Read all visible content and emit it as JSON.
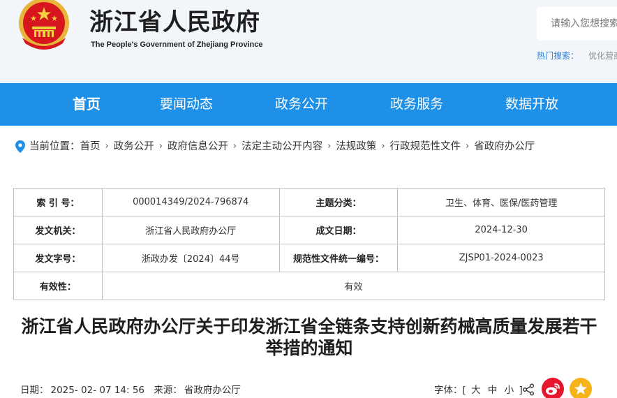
{
  "header": {
    "title": "浙江省人民政府",
    "subtitle": "The People's Government of Zhejiang Province",
    "search_placeholder": "请输入您想搜索的内容",
    "hot_search_label": "热门搜索：",
    "hot_search_items": [
      "优化营商环境"
    ]
  },
  "nav": {
    "items": [
      {
        "label": "首页",
        "active": true
      },
      {
        "label": "要闻动态",
        "active": false
      },
      {
        "label": "政务公开",
        "active": false
      },
      {
        "label": "政务服务",
        "active": false
      },
      {
        "label": "数据开放",
        "active": false
      }
    ]
  },
  "breadcrumb": {
    "label": "当前位置：",
    "items": [
      "首页",
      "政务公开",
      "政府信息公开",
      "法定主动公开内容",
      "法规政策",
      "行政规范性文件",
      "省政府办公厅"
    ],
    "separator": "›"
  },
  "meta": {
    "rows": [
      [
        {
          "label": "索 引 号：",
          "value": "000014349/2024-796874"
        },
        {
          "label": "主题分类：",
          "value": "卫生、体育、医保/医药管理"
        }
      ],
      [
        {
          "label": "发文机关：",
          "value": "浙江省人民政府办公厅"
        },
        {
          "label": "成文日期：",
          "value": "2024-12-30"
        }
      ],
      [
        {
          "label": "发文字号：",
          "value": "浙政办发〔2024〕44号"
        },
        {
          "label": "规范性文件统一编号：",
          "value": "ZJSP01-2024-0023"
        }
      ]
    ],
    "validity_label": "有效性：",
    "validity_value": "有效"
  },
  "article": {
    "title": "浙江省人民政府办公厅关于印发浙江省全链条支持创新药械高质量发展若干举措的通知",
    "date_label": "日期：",
    "date_value": "2025- 02- 07 14: 56",
    "source_label": "来源：",
    "source_value": "省政府办公厅",
    "font_label": "字体：",
    "font_bracket_open": "[",
    "font_options": [
      "大",
      "中",
      "小"
    ],
    "font_bracket_close": "]"
  },
  "colors": {
    "nav_bg": "#1e90e8",
    "header_bg": "#f2f6fb",
    "hot_label": "#2f7fd8",
    "weibo": "#e6162d",
    "star": "#f5b21b",
    "emblem_red": "#d7161e",
    "emblem_gold": "#f1c232"
  },
  "icons": {
    "location": "location-pin-icon",
    "share": "share-icon",
    "weibo": "weibo-icon",
    "favorite": "star-icon"
  }
}
